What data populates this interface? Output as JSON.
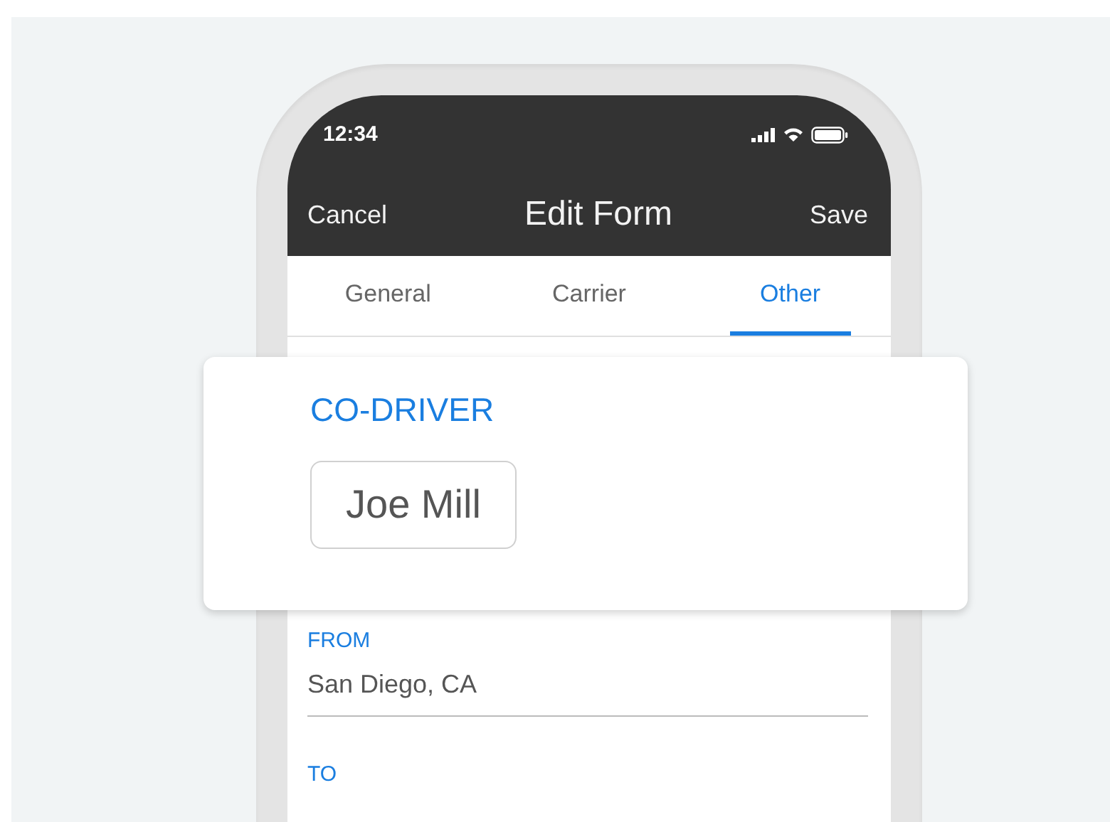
{
  "status_bar": {
    "time": "12:34"
  },
  "nav_bar": {
    "cancel": "Cancel",
    "title": "Edit Form",
    "save": "Save"
  },
  "tabs": [
    {
      "label": "General",
      "selected": false
    },
    {
      "label": "Carrier",
      "selected": false
    },
    {
      "label": "Other",
      "selected": true
    }
  ],
  "co_driver_card": {
    "label": "CO-DRIVER",
    "value": "Joe Mill"
  },
  "fields": [
    {
      "label": "FROM",
      "value": "San Diego, CA"
    },
    {
      "label": "TO"
    }
  ]
}
